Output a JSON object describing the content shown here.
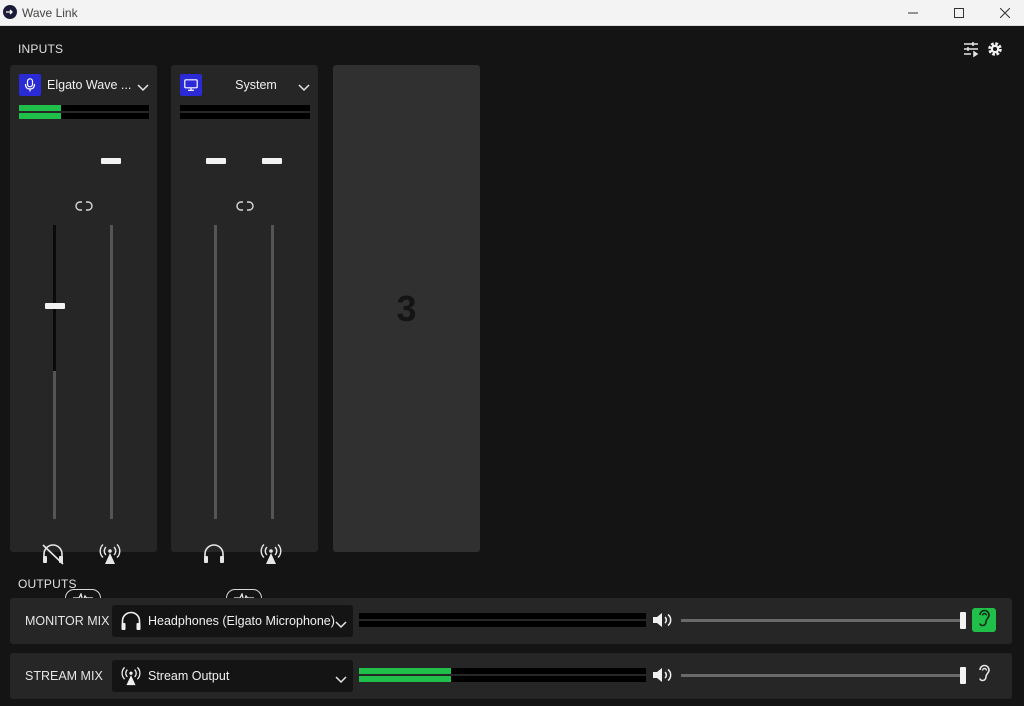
{
  "window": {
    "title": "Wave Link"
  },
  "inputs": {
    "label": "INPUTS",
    "channels": [
      {
        "name": "Elgato Wave ...",
        "icon": "microphone-icon",
        "meter_level": 0.32,
        "monitor_level": 0.5,
        "stream_level": 1.0,
        "monitor_muted": true
      },
      {
        "name": "System",
        "icon": "monitor-icon",
        "meter_level": 0.0,
        "monitor_level": 1.0,
        "stream_level": 1.0,
        "monitor_muted": false
      }
    ],
    "empty_slot": {
      "label": "3"
    }
  },
  "outputs": {
    "label": "OUTPUTS",
    "mixes": [
      {
        "name": "MONITOR MIX",
        "device": "Headphones (Elgato Microphone)",
        "device_icon": "headphones-icon",
        "meter_level": 0.0,
        "volume": 1.0,
        "listening": true
      },
      {
        "name": "STREAM MIX",
        "device": "Stream Output",
        "device_icon": "broadcast-icon",
        "meter_level": 0.32,
        "volume": 1.0,
        "listening": false
      }
    ]
  },
  "colors": {
    "accent": "#1fbf4a",
    "channel_icon_bg": "#2a2ad6",
    "background": "#141414",
    "panel": "#262626"
  }
}
